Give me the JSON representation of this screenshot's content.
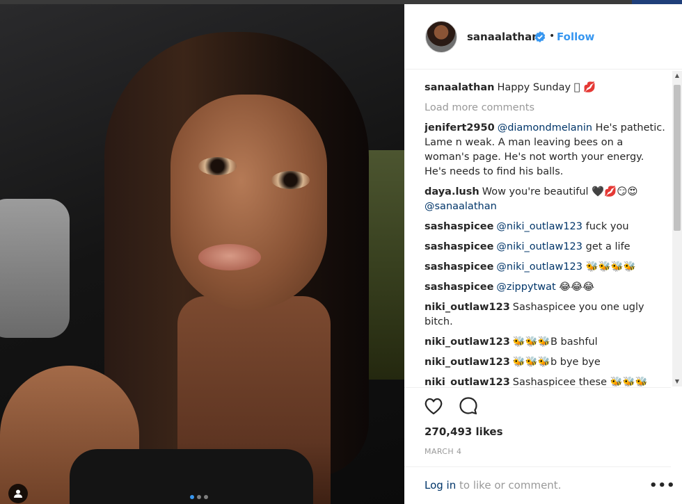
{
  "post": {
    "handle": "sanaalathan",
    "follow_label": "Follow",
    "separator": "•",
    "likes": "270,493 likes",
    "date": "MARCH 4",
    "carousel": {
      "count": 3,
      "active": 1
    }
  },
  "caption": {
    "user": "sanaalathan",
    "text": "Happy Sunday 🏽 💋"
  },
  "load_more": "Load more comments",
  "comments": [
    {
      "user": "jenifert2950",
      "mention": "@diamondmelanin",
      "text": " He's pathetic. Lame n weak. A man leaving bees on a woman's page. He's not worth your energy. He's needs to find his balls."
    },
    {
      "user": "daya.lush",
      "mention": "",
      "text": "Wow you're beautiful 🖤💋😏😍 ",
      "mention2": "@sanaalathan"
    },
    {
      "user": "sashaspicee",
      "mention": "@niki_outlaw123",
      "text": " fuck you"
    },
    {
      "user": "sashaspicee",
      "mention": "@niki_outlaw123",
      "text": " get a life"
    },
    {
      "user": "sashaspicee",
      "mention": "@niki_outlaw123",
      "text": " 🐝🐝🐝🐝"
    },
    {
      "user": "sashaspicee",
      "mention": "@zippytwat",
      "text": " 😂😂😂"
    },
    {
      "user": "niki_outlaw123",
      "mention": "",
      "text": "Sashaspicee you one ugly bitch."
    },
    {
      "user": "niki_outlaw123",
      "mention": "",
      "text": "🐝🐝🐝B bashful"
    },
    {
      "user": "niki_outlaw123",
      "mention": "",
      "text": "🐝🐝🐝b bye bye"
    },
    {
      "user": "niki_outlaw123",
      "mention": "",
      "text": "Sashaspicee these 🐝🐝🐝"
    }
  ],
  "footer": {
    "login_link": "Log in",
    "login_text": " to like or comment.",
    "more": "•••"
  },
  "colors": {
    "link": "#3897f0",
    "mention": "#003569",
    "muted": "#999999"
  }
}
